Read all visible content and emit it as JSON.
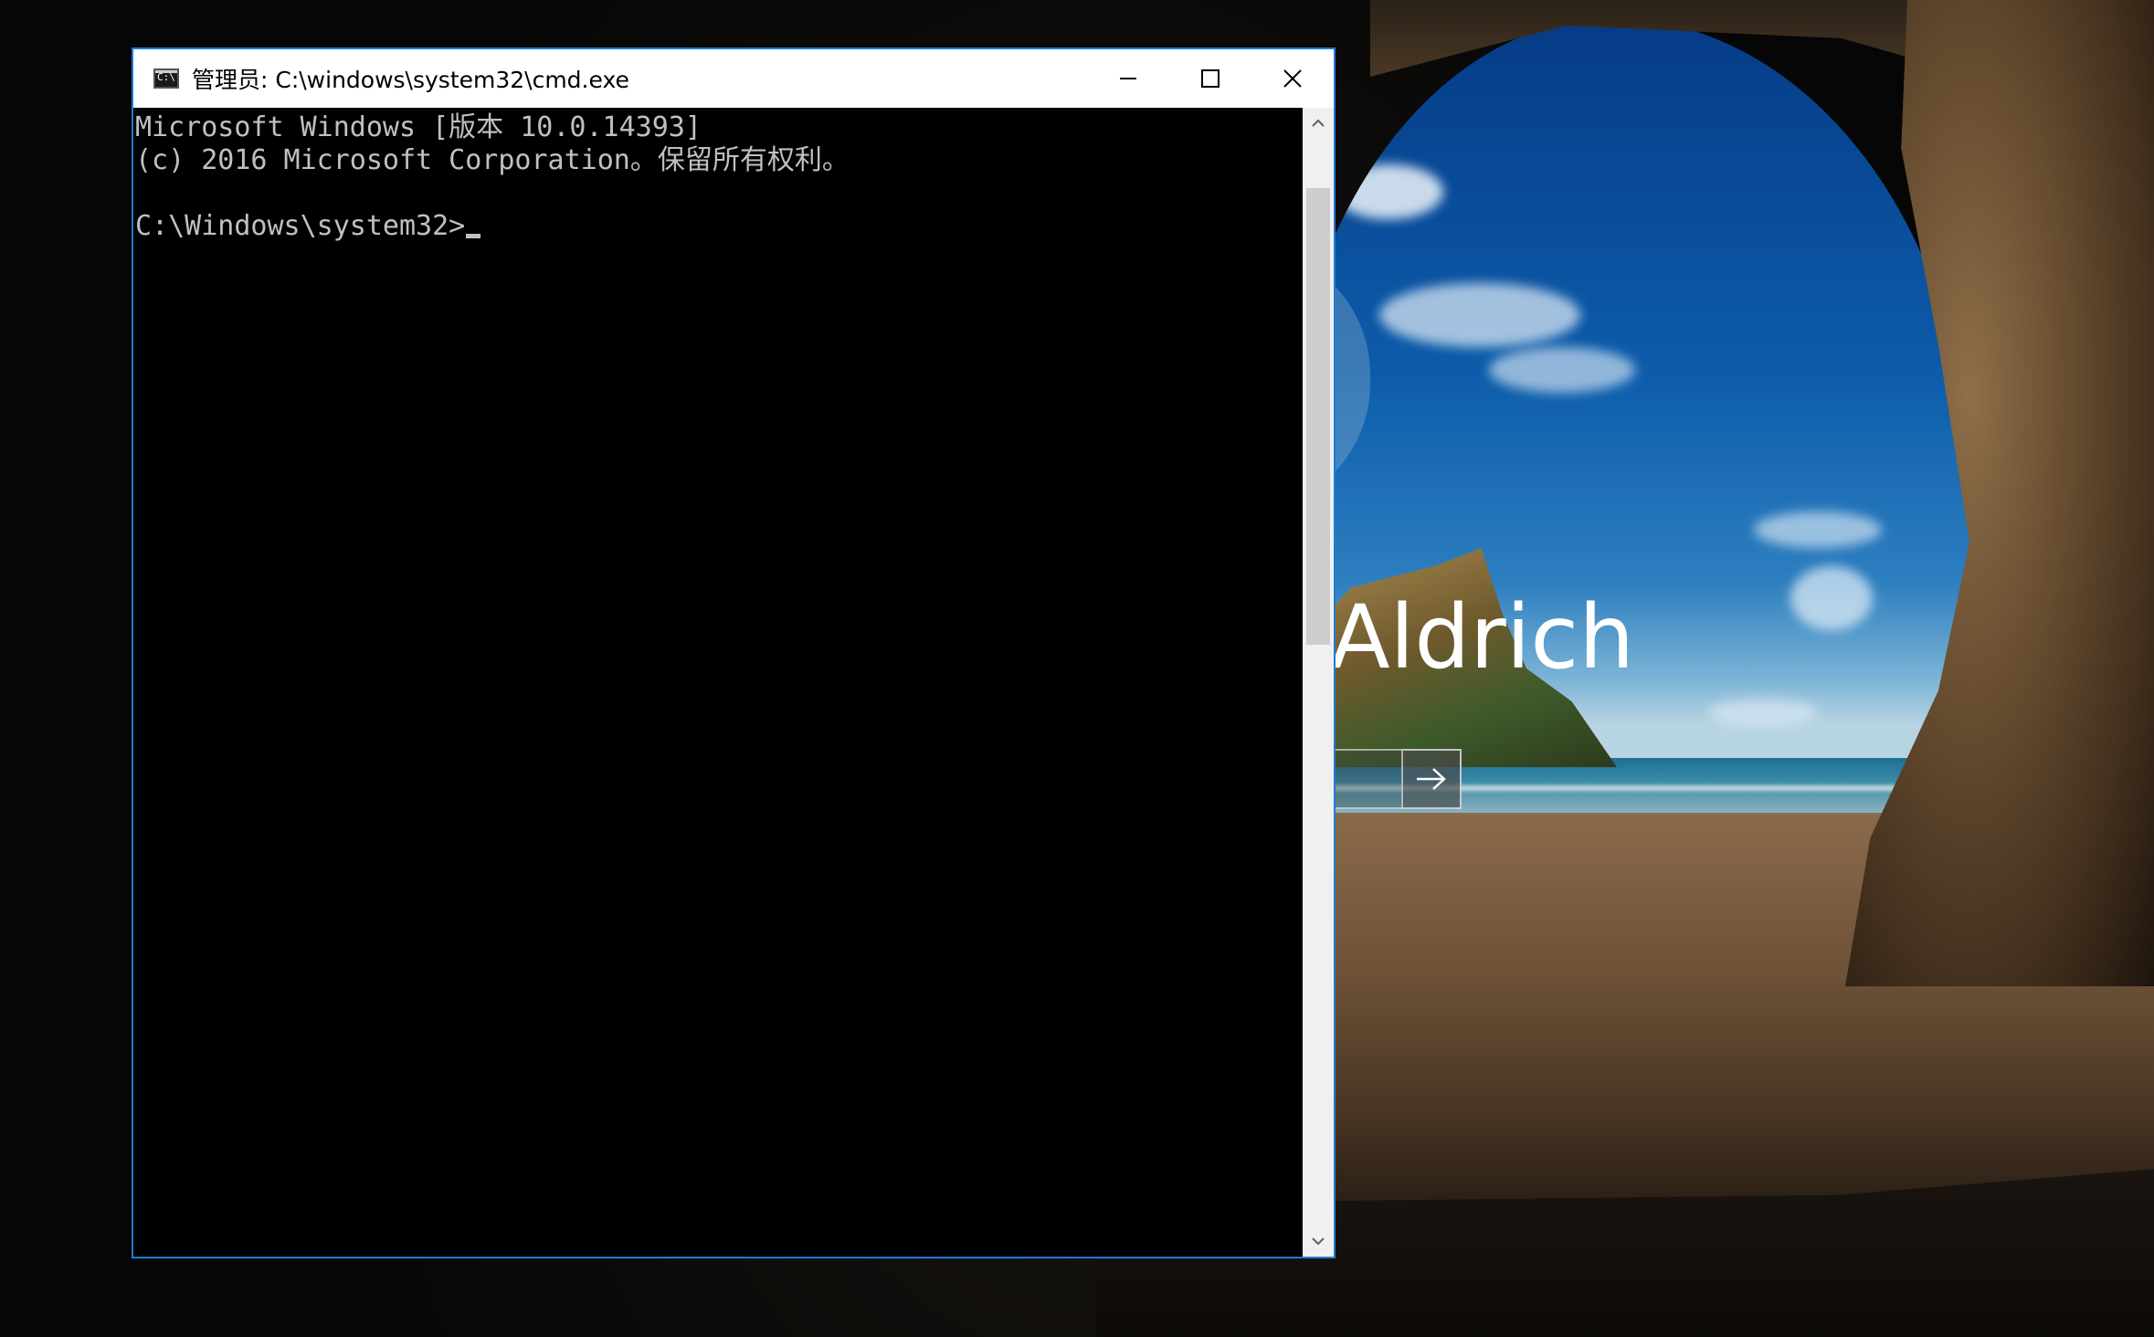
{
  "window": {
    "title": "管理员: C:\\windows\\system32\\cmd.exe",
    "icon": "cmd-app-icon",
    "controls": [
      "minimize-icon",
      "maximize-icon",
      "close-icon"
    ]
  },
  "console": {
    "lines": [
      "Microsoft Windows [版本 10.0.14393]",
      "(c) 2016 Microsoft Corporation。保留所有权利。",
      "",
      "C:\\Windows\\system32>"
    ]
  },
  "lockscreen": {
    "user_name": "Aldrich",
    "submit_icon": "arrow-right-icon"
  },
  "colors": {
    "window_border": "#1e7bd4",
    "console_bg": "#000000",
    "console_text": "#c0c0c0",
    "titlebar_bg": "#ffffff"
  }
}
